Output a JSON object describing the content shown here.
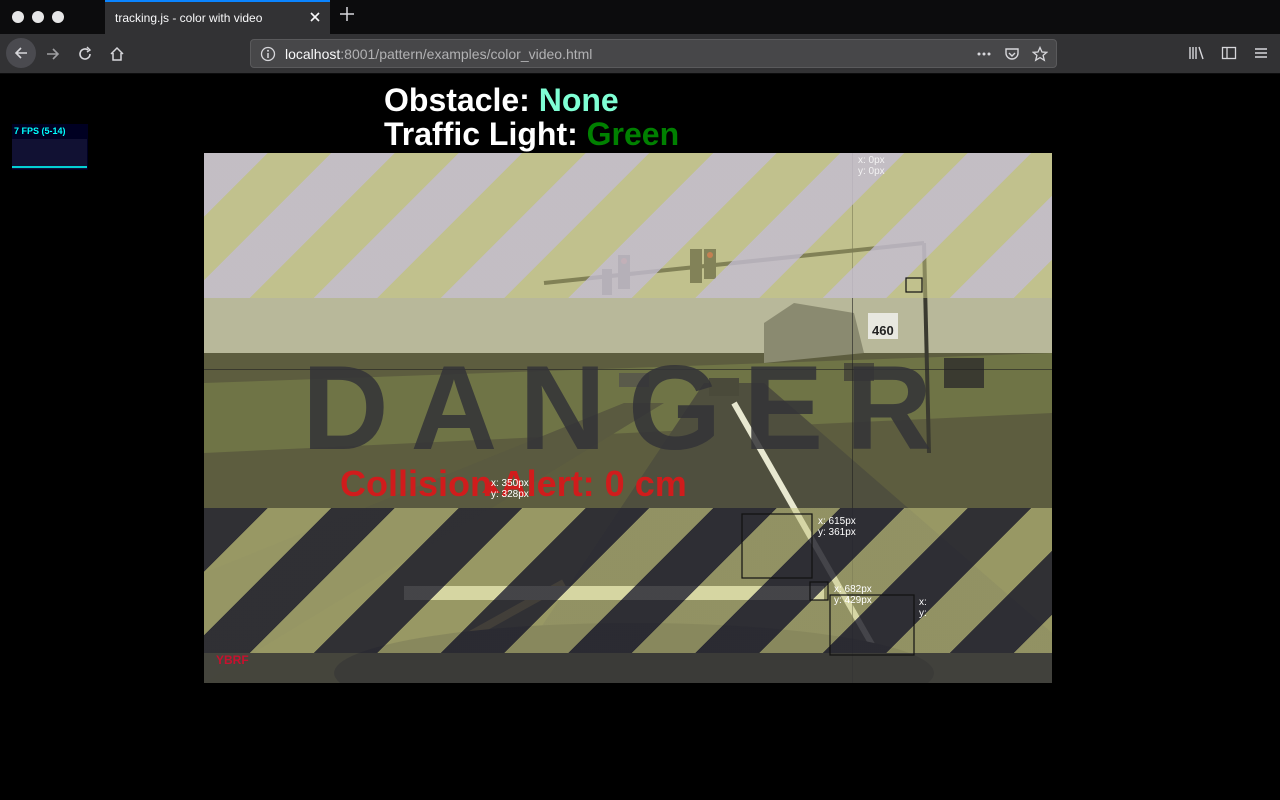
{
  "browser": {
    "tab_title": "tracking.js - color with video",
    "url_host": "localhost",
    "url_rest": ":8001/pattern/examples/color_video.html"
  },
  "stats": {
    "fps_label": "7 FPS (5-14)"
  },
  "status": {
    "obstacle_label": "Obstacle",
    "obstacle_value": "None",
    "traffic_label": "Traffic Light",
    "traffic_value": "Green",
    "separator": ": "
  },
  "video": {
    "danger_text": "DANGER",
    "collision_text": "Collision Alert: 0 cm",
    "brand_mark": "YBRF",
    "coords": [
      {
        "x": "x: 0px",
        "y": "y: 0px"
      },
      {
        "x": "x: 350px",
        "y": "y: 328px"
      },
      {
        "x": "x: 615px",
        "y": "y: 361px"
      },
      {
        "x": "x: 682px",
        "y": "y: 429px"
      },
      {
        "x": "x:",
        "y": "y:"
      }
    ],
    "sign_number": "460"
  },
  "colors": {
    "obstacle_value": "#7fffd4",
    "traffic_value": "#008000",
    "collision": "#d01c1c",
    "accent": "#0a84ff"
  }
}
